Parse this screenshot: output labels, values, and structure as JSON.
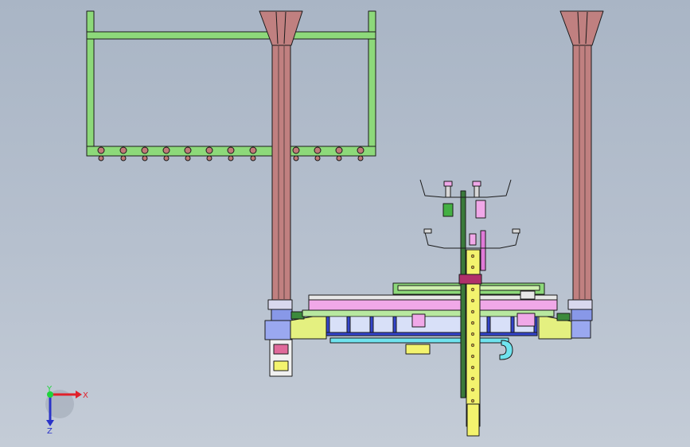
{
  "triad": {
    "x_label": "X",
    "y_label": "Y",
    "z_label": "Z",
    "x_color": "#e0202a",
    "y_color": "#1fd43c",
    "z_color": "#2a33c8"
  },
  "colors": {
    "background": "#b0bbca",
    "frame_green": "#8dd97a",
    "column_brown": "#c08080",
    "mast_yellow": "#f3f36e",
    "pink_rail": "#f0a8e8",
    "blue_strut": "#3344cc",
    "cyan_pipe": "#6fe3ee",
    "outline": "#1a1a1a"
  }
}
